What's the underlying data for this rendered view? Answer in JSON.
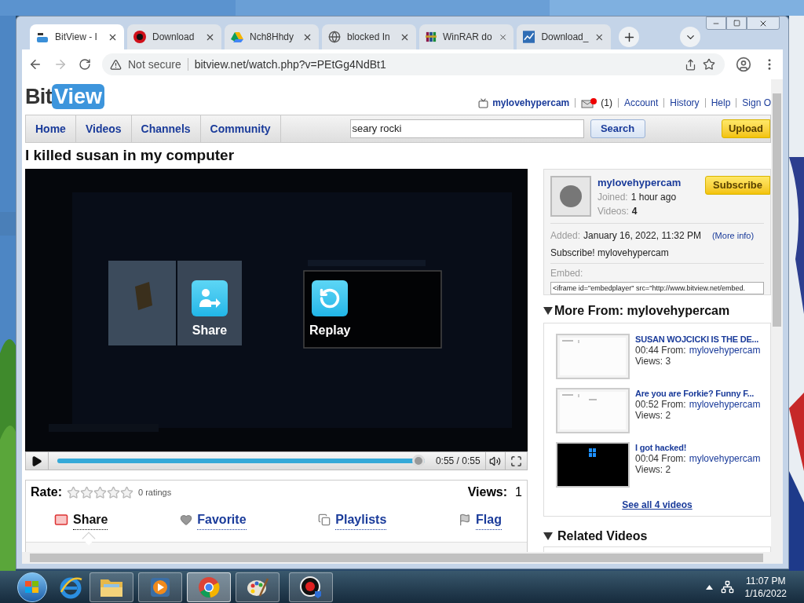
{
  "browser": {
    "tabs": [
      {
        "title": "BitView - I",
        "kind": "bitview",
        "selected": true
      },
      {
        "title": "Download",
        "kind": "record",
        "selected": false
      },
      {
        "title": "Nch8Hhdy",
        "kind": "drive",
        "selected": false
      },
      {
        "title": "blocked In",
        "kind": "globe",
        "selected": false
      },
      {
        "title": "WinRAR do",
        "kind": "winrar",
        "selected": false
      },
      {
        "title": "Download_",
        "kind": "chart",
        "selected": false
      }
    ],
    "address": {
      "security": "Not secure",
      "url": "bitview.net/watch.php?v=PEtGg4NdBt1"
    }
  },
  "header": {
    "logo": [
      "Bit",
      "View"
    ],
    "username": "mylovehypercam",
    "inbox": "(1)",
    "links": [
      "Account",
      "History",
      "Help",
      "Sign O"
    ]
  },
  "nav": {
    "items": [
      "Home",
      "Videos",
      "Channels",
      "Community"
    ],
    "search": {
      "value": "seary rocki",
      "button": "Search"
    },
    "upload": "Upload"
  },
  "video": {
    "title": "I killed susan in my computer",
    "overlay": [
      {
        "kind": "share",
        "label": "Share"
      },
      {
        "kind": "replay",
        "label": "Replay"
      }
    ],
    "progress": {
      "level": 1
    },
    "time": "0:55 / 0:55"
  },
  "rating": {
    "label": "Rate:",
    "stars": 0,
    "count": "0 ratings",
    "views_label": "Views:",
    "views": "1"
  },
  "actions": [
    {
      "kind": "share",
      "label": "Share",
      "selected": true
    },
    {
      "kind": "favorite",
      "label": "Favorite",
      "selected": false
    },
    {
      "kind": "playlists",
      "label": "Playlists",
      "selected": false
    },
    {
      "kind": "flag",
      "label": "Flag",
      "selected": false
    }
  ],
  "channel": {
    "name": "mylovehypercam",
    "joined_label": "Joined:",
    "joined": "1 hour ago",
    "videos_label": "Videos:",
    "videos": "4",
    "subscribe": "Subscribe",
    "added_label": "Added:",
    "added": "January 16, 2022, 11:32 PM",
    "more_info": "(More info)",
    "description": "Subscribe! mylovehypercam",
    "embed_label": "Embed:",
    "embed_code": "<iframe id=\"embedplayer\" src=\"http://www.bitview.net/embed."
  },
  "more_from": {
    "title": "More From: mylovehypercam",
    "videos": [
      {
        "title": "SUSAN WOJCICKI IS THE DE...",
        "meta": "00:44 From:",
        "author": "mylovehypercam",
        "views": "Views: 3"
      },
      {
        "title": "Are you are Forkie? Funny F...",
        "meta": "00:52 From:",
        "author": "mylovehypercam",
        "views": "Views: 2"
      },
      {
        "title": "I got hacked!",
        "meta": "00:04 From:",
        "author": "mylovehypercam",
        "views": "Views: 2"
      }
    ],
    "see_all": "See all 4 videos"
  },
  "related": {
    "title": "Related Videos"
  },
  "taskbar": {
    "apps": [
      {
        "kind": "ie",
        "running": false,
        "selected": false
      },
      {
        "kind": "explorer",
        "running": true,
        "selected": false
      },
      {
        "kind": "media",
        "running": true,
        "selected": false
      },
      {
        "kind": "chrome",
        "running": true,
        "selected": true
      },
      {
        "kind": "paint",
        "running": true,
        "selected": false
      },
      {
        "kind": "recorder",
        "running": true,
        "selected": false
      }
    ],
    "time": "11:07 PM",
    "date": "1/16/2022"
  }
}
